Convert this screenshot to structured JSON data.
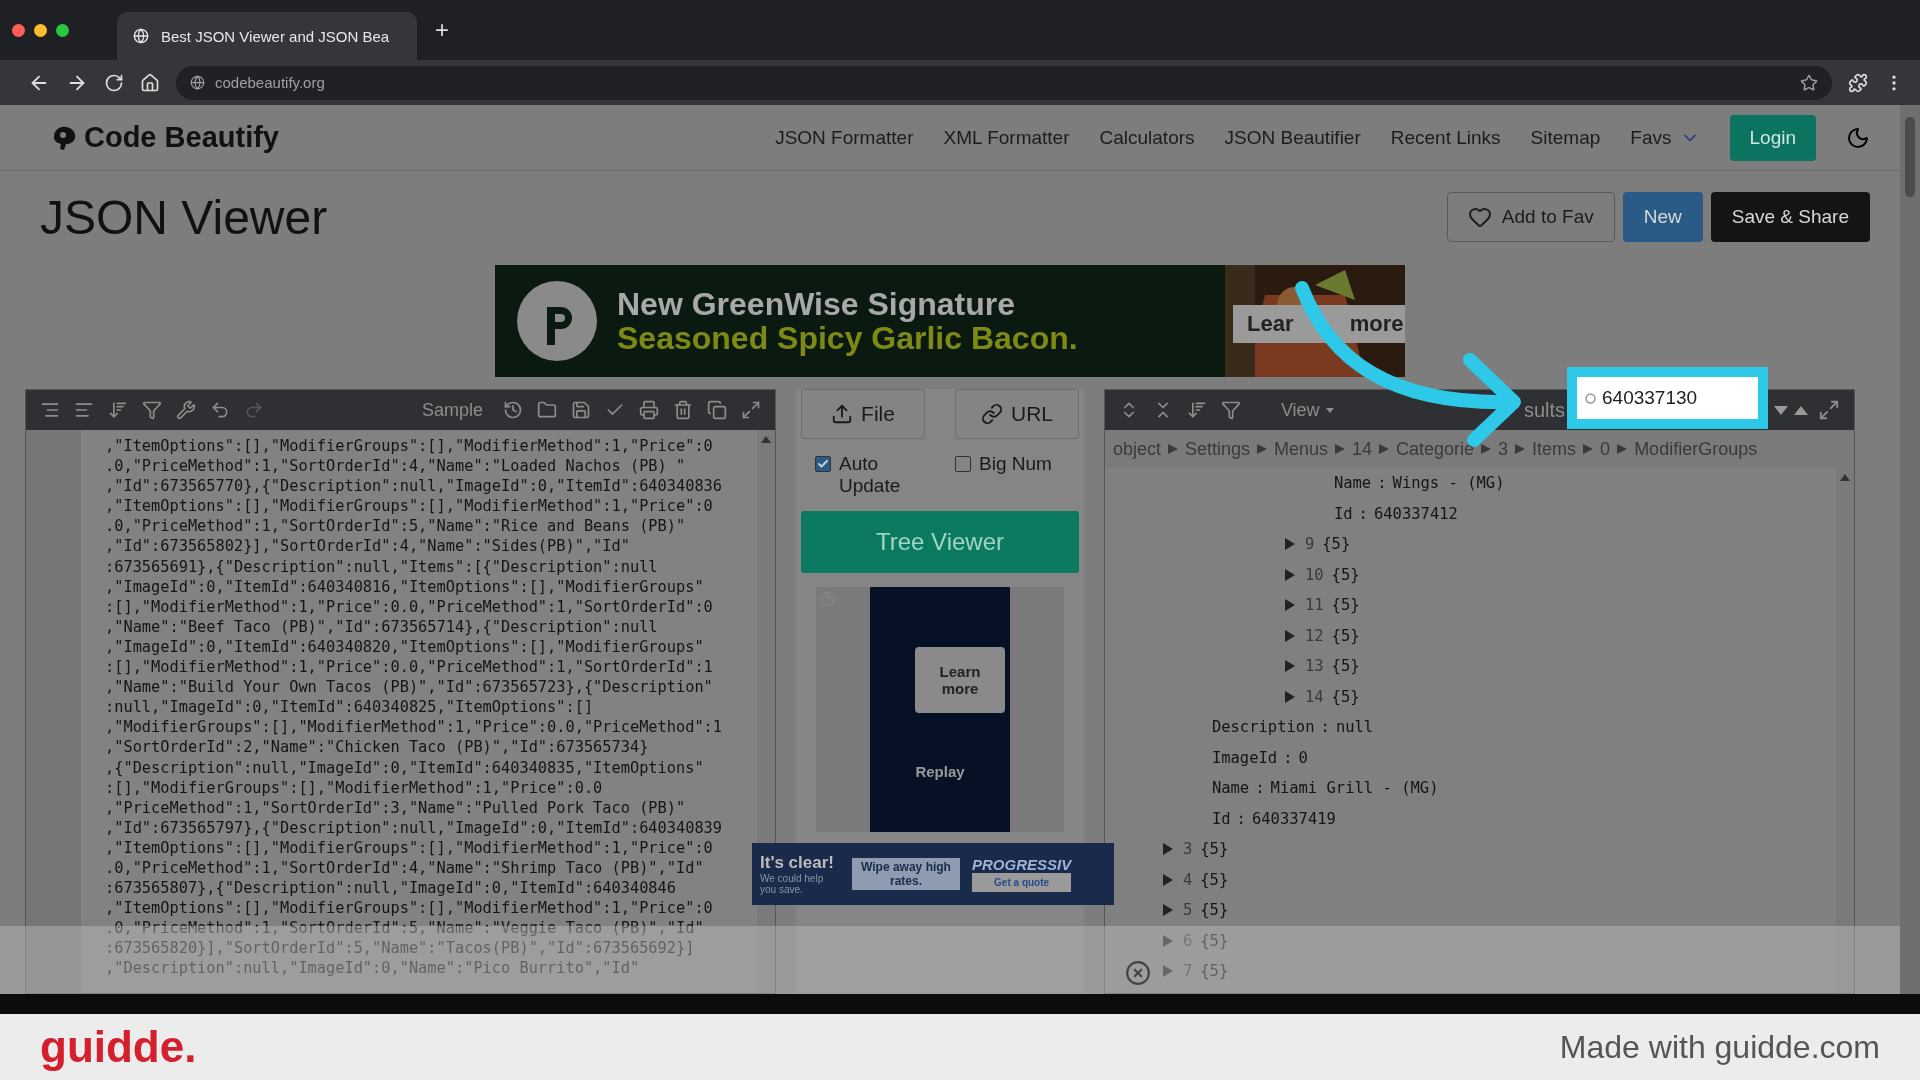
{
  "browser": {
    "tab_title": "Best JSON Viewer and JSON Bea",
    "new_tab": "+",
    "url": "codebeautify.org"
  },
  "site": {
    "logo": "Code Beautify",
    "nav": [
      "JSON Formatter",
      "XML Formatter",
      "Calculators",
      "JSON Beautifier",
      "Recent Links",
      "Sitemap",
      "Favs"
    ],
    "login": "Login"
  },
  "page": {
    "title": "JSON Viewer",
    "actions": [
      {
        "kind": "outline",
        "label": "Add to Fav"
      },
      {
        "kind": "primary",
        "label": "New"
      },
      {
        "kind": "dark",
        "label": "Save & Share"
      }
    ]
  },
  "banner_ad": {
    "line_1": "New GreenWise Signature",
    "line_2": "Seasoned Spicy Garlic Bacon.",
    "button": "Lear  more"
  },
  "editor": {
    "sample": "Sample",
    "lines": [
      ",\"ItemOptions\":[],\"ModifierGroups\":[],\"ModifierMethod\":1,\"Price\":0",
      ".0,\"PriceMethod\":1,\"SortOrderId\":4,\"Name\":\"Loaded Nachos (PB) \"",
      ",\"Id\":673565770},{\"Description\":null,\"ImageId\":0,\"ItemId\":640340836",
      ",\"ItemOptions\":[],\"ModifierGroups\":[],\"ModifierMethod\":1,\"Price\":0",
      ".0,\"PriceMethod\":1,\"SortOrderId\":5,\"Name\":\"Rice and Beans (PB)\"",
      ",\"Id\":673565802}],\"SortOrderId\":4,\"Name\":\"Sides(PB)\",\"Id\"",
      ":673565691},{\"Description\":null,\"Items\":[{\"Description\":null",
      ",\"ImageId\":0,\"ItemId\":640340816,\"ItemOptions\":[],\"ModifierGroups\"",
      ":[],\"ModifierMethod\":1,\"Price\":0.0,\"PriceMethod\":1,\"SortOrderId\":0",
      ",\"Name\":\"Beef Taco (PB)\",\"Id\":673565714},{\"Description\":null",
      ",\"ImageId\":0,\"ItemId\":640340820,\"ItemOptions\":[],\"ModifierGroups\"",
      ":[],\"ModifierMethod\":1,\"Price\":0.0,\"PriceMethod\":1,\"SortOrderId\":1",
      ",\"Name\":\"Build Your Own Tacos (PB)\",\"Id\":673565723},{\"Description\"",
      ":null,\"ImageId\":0,\"ItemId\":640340825,\"ItemOptions\":[]",
      ",\"ModifierGroups\":[],\"ModifierMethod\":1,\"Price\":0.0,\"PriceMethod\":1",
      ",\"SortOrderId\":2,\"Name\":\"Chicken Taco (PB)\",\"Id\":673565734}",
      ",{\"Description\":null,\"ImageId\":0,\"ItemId\":640340835,\"ItemOptions\"",
      ":[],\"ModifierGroups\":[],\"ModifierMethod\":1,\"Price\":0.0",
      ",\"PriceMethod\":1,\"SortOrderId\":3,\"Name\":\"Pulled Pork Taco (PB)\"",
      ",\"Id\":673565797},{\"Description\":null,\"ImageId\":0,\"ItemId\":640340839",
      ",\"ItemOptions\":[],\"ModifierGroups\":[],\"ModifierMethod\":1,\"Price\":0",
      ".0,\"PriceMethod\":1,\"SortOrderId\":4,\"Name\":\"Shrimp Taco (PB)\",\"Id\"",
      ":673565807},{\"Description\":null,\"ImageId\":0,\"ItemId\":640340846",
      ",\"ItemOptions\":[],\"ModifierGroups\":[],\"ModifierMethod\":1,\"Price\":0",
      ".0,\"PriceMethod\":1,\"SortOrderId\":5,\"Name\":\"Veggie Taco (PB)\",\"Id\"",
      ":673565820}],\"SortOrderId\":5,\"Name\":\"Tacos(PB)\",\"Id\":673565692}]",
      ",\"Description\":null,\"ImageId\":0,\"Name\":\"Pico Burrito\",\"Id\""
    ]
  },
  "middle": {
    "file": "File",
    "url": "URL",
    "options": [
      {
        "label": "Auto Update",
        "checked": true
      },
      {
        "label": "Big Num",
        "checked": false
      }
    ],
    "tree_viewer": "Tree Viewer",
    "video_ad": {
      "button": "Learn more",
      "replay": "Replay"
    }
  },
  "bottom_ad": {
    "headline": "It's clear!",
    "subline": "We could help you save.",
    "middle": "Wipe away high rates.",
    "brand": "PROGRESSIV",
    "button": "Get a quote"
  },
  "viewer": {
    "view": "View",
    "results": "sults",
    "search": {
      "value": "640337130"
    },
    "breadcrumb": [
      "object",
      "Settings",
      "Menus",
      "14",
      "Categorie",
      "3",
      "Items",
      "0",
      "ModifierGroups"
    ],
    "separator": ":",
    "tree": [
      {
        "kind": "continued",
        "children": [
          {
            "kind": "continued",
            "children": [
              {
                "kind": "continued",
                "children": [
                  {
                    "kind": "property",
                    "key": "Name",
                    "value": "Wings - (MG)"
                  },
                  {
                    "kind": "property",
                    "key": "Id",
                    "value": "640337412"
                  }
                ]
              },
              {
                "kind": "node",
                "key": "9",
                "count": "{5}"
              },
              {
                "kind": "node",
                "key": "10",
                "count": "{5}"
              },
              {
                "kind": "node",
                "key": "11",
                "count": "{5}"
              },
              {
                "kind": "node",
                "key": "12",
                "count": "{5}"
              },
              {
                "kind": "node",
                "key": "13",
                "count": "{5}"
              },
              {
                "kind": "node",
                "key": "14",
                "count": "{5}"
              }
            ]
          },
          {
            "kind": "property",
            "key": "Description",
            "value": "null"
          },
          {
            "kind": "property",
            "key": "ImageId",
            "value": "0"
          },
          {
            "kind": "property",
            "key": "Name",
            "value": "Miami Grill - (MG)"
          },
          {
            "kind": "property",
            "key": "Id",
            "value": "640337419"
          }
        ]
      },
      {
        "kind": "node",
        "key": "3",
        "count": "{5}"
      },
      {
        "kind": "node",
        "key": "4",
        "count": "{5}"
      },
      {
        "kind": "node",
        "key": "5",
        "count": "{5}"
      },
      {
        "kind": "node",
        "key": "6",
        "count": "{5}"
      },
      {
        "kind": "node",
        "key": "7",
        "count": "{5}"
      }
    ]
  },
  "footer": {
    "logo": "guidde.",
    "credit": "Made with guidde.com"
  }
}
